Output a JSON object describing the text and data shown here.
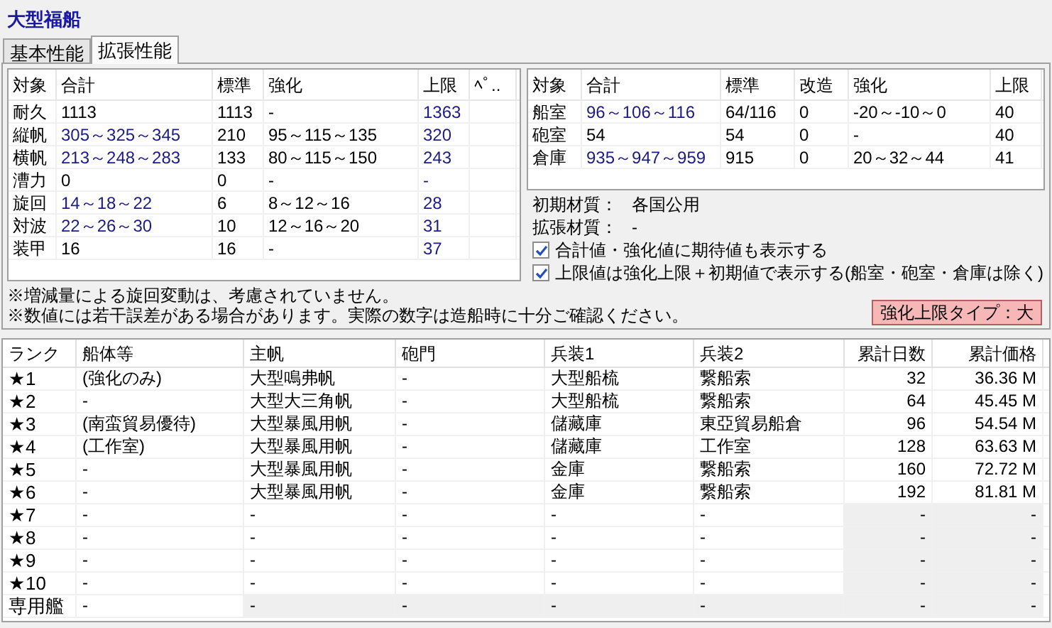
{
  "title": "大型福船",
  "tabs": [
    {
      "label": "基本性能",
      "selected": false
    },
    {
      "label": "拡張性能",
      "selected": true
    }
  ],
  "stats_table": {
    "columns": [
      "対象",
      "合計",
      "標準",
      "強化",
      "上限",
      "ﾍﾟ.."
    ],
    "rows": [
      {
        "cells": [
          {
            "text": "耐久",
            "accent": false
          },
          {
            "text": "1113",
            "accent": false
          },
          {
            "text": "1113",
            "accent": false
          },
          {
            "text": "-",
            "accent": false
          },
          {
            "text": "1363",
            "accent": true
          }
        ]
      },
      {
        "cells": [
          {
            "text": "縦帆",
            "accent": false
          },
          {
            "text": "305～325～345",
            "accent": true
          },
          {
            "text": "210",
            "accent": false
          },
          {
            "text": "95～115～135",
            "accent": false
          },
          {
            "text": "320",
            "accent": true
          }
        ]
      },
      {
        "cells": [
          {
            "text": "横帆",
            "accent": false
          },
          {
            "text": "213～248～283",
            "accent": true
          },
          {
            "text": "133",
            "accent": false
          },
          {
            "text": "80～115～150",
            "accent": false
          },
          {
            "text": "243",
            "accent": true
          }
        ]
      },
      {
        "cells": [
          {
            "text": "漕力",
            "accent": false
          },
          {
            "text": "0",
            "accent": false
          },
          {
            "text": "0",
            "accent": false
          },
          {
            "text": "-",
            "accent": false
          },
          {
            "text": "-",
            "accent": true
          }
        ]
      },
      {
        "cells": [
          {
            "text": "旋回",
            "accent": false
          },
          {
            "text": "14～18～22",
            "accent": true
          },
          {
            "text": "6",
            "accent": false
          },
          {
            "text": "8～12～16",
            "accent": false
          },
          {
            "text": "28",
            "accent": true
          }
        ]
      },
      {
        "cells": [
          {
            "text": "対波",
            "accent": false
          },
          {
            "text": "22～26～30",
            "accent": true
          },
          {
            "text": "10",
            "accent": false
          },
          {
            "text": "12～16～20",
            "accent": false
          },
          {
            "text": "31",
            "accent": true
          }
        ]
      },
      {
        "cells": [
          {
            "text": "装甲",
            "accent": false
          },
          {
            "text": "16",
            "accent": false
          },
          {
            "text": "16",
            "accent": false
          },
          {
            "text": "-",
            "accent": false
          },
          {
            "text": "37",
            "accent": true
          }
        ]
      }
    ]
  },
  "capacity_table": {
    "columns": [
      "対象",
      "合計",
      "標準",
      "改造",
      "強化",
      "上限"
    ],
    "rows": [
      {
        "cells": [
          {
            "text": "船室",
            "accent": false
          },
          {
            "text": "96～106～116",
            "accent": true
          },
          {
            "text": "64/116",
            "accent": false
          },
          {
            "text": "0",
            "accent": false
          },
          {
            "text": "-20～-10～0",
            "accent": false
          },
          {
            "text": "40",
            "accent": false
          }
        ]
      },
      {
        "cells": [
          {
            "text": "砲室",
            "accent": false
          },
          {
            "text": "54",
            "accent": false
          },
          {
            "text": "54",
            "accent": false
          },
          {
            "text": "0",
            "accent": false
          },
          {
            "text": "-",
            "accent": false
          },
          {
            "text": "40",
            "accent": false
          }
        ]
      },
      {
        "cells": [
          {
            "text": "倉庫",
            "accent": false
          },
          {
            "text": "935～947～959",
            "accent": true
          },
          {
            "text": "915",
            "accent": false
          },
          {
            "text": "0",
            "accent": false
          },
          {
            "text": "20～32～44",
            "accent": false
          },
          {
            "text": "41",
            "accent": false
          }
        ]
      }
    ]
  },
  "materials": [
    {
      "label": "初期材質：",
      "value": "各国公用"
    },
    {
      "label": "拡張材質：",
      "value": "-"
    }
  ],
  "options": [
    {
      "label": "合計値・強化値に期待値も表示する",
      "checked": true
    },
    {
      "label": "上限値は強化上限＋初期値で表示する(船室・砲室・倉庫は除く)",
      "checked": true
    }
  ],
  "notes": [
    "※増減量による旋回変動は、考慮されていません。",
    "※数値には若干誤差がある場合があります。実際の数字は造船時に十分ご確認ください。"
  ],
  "limit_type": "強化上限タイプ：大",
  "upgrade_table": {
    "columns": [
      "ランク",
      "船体等",
      "主帆",
      "砲門",
      "兵装1",
      "兵装2",
      "累計日数",
      "累計価格"
    ],
    "rows": [
      {
        "cells": [
          {
            "text": "★1",
            "disabled": false
          },
          {
            "text": "(強化のみ)",
            "disabled": false
          },
          {
            "text": "大型鳴弗帆",
            "disabled": false
          },
          {
            "text": "-",
            "disabled": false
          },
          {
            "text": "大型船梳",
            "disabled": false
          },
          {
            "text": "繋船索",
            "disabled": false
          },
          {
            "text": "32",
            "disabled": false
          },
          {
            "text": "36.36 M",
            "disabled": false
          }
        ]
      },
      {
        "cells": [
          {
            "text": "★2",
            "disabled": false
          },
          {
            "text": "-",
            "disabled": false
          },
          {
            "text": "大型大三角帆",
            "disabled": false
          },
          {
            "text": "-",
            "disabled": false
          },
          {
            "text": "大型船梳",
            "disabled": false
          },
          {
            "text": "繋船索",
            "disabled": false
          },
          {
            "text": "64",
            "disabled": false
          },
          {
            "text": "45.45 M",
            "disabled": false
          }
        ]
      },
      {
        "cells": [
          {
            "text": "★3",
            "disabled": false
          },
          {
            "text": "(南蛮貿易優待)",
            "disabled": false
          },
          {
            "text": "大型暴風用帆",
            "disabled": false
          },
          {
            "text": "-",
            "disabled": false
          },
          {
            "text": "儲藏庫",
            "disabled": false
          },
          {
            "text": "東亞貿易船倉",
            "disabled": false
          },
          {
            "text": "96",
            "disabled": false
          },
          {
            "text": "54.54 M",
            "disabled": false
          }
        ]
      },
      {
        "cells": [
          {
            "text": "★4",
            "disabled": false
          },
          {
            "text": "(工作室)",
            "disabled": false
          },
          {
            "text": "大型暴風用帆",
            "disabled": false
          },
          {
            "text": "-",
            "disabled": false
          },
          {
            "text": "儲藏庫",
            "disabled": false
          },
          {
            "text": "工作室",
            "disabled": false
          },
          {
            "text": "128",
            "disabled": false
          },
          {
            "text": "63.63 M",
            "disabled": false
          }
        ]
      },
      {
        "cells": [
          {
            "text": "★5",
            "disabled": false
          },
          {
            "text": "-",
            "disabled": false
          },
          {
            "text": "大型暴風用帆",
            "disabled": false
          },
          {
            "text": "-",
            "disabled": false
          },
          {
            "text": "金庫",
            "disabled": false
          },
          {
            "text": "繋船索",
            "disabled": false
          },
          {
            "text": "160",
            "disabled": false
          },
          {
            "text": "72.72 M",
            "disabled": false
          }
        ]
      },
      {
        "cells": [
          {
            "text": "★6",
            "disabled": false
          },
          {
            "text": "-",
            "disabled": false
          },
          {
            "text": "大型暴風用帆",
            "disabled": false
          },
          {
            "text": "-",
            "disabled": false
          },
          {
            "text": "金庫",
            "disabled": false
          },
          {
            "text": "繋船索",
            "disabled": false
          },
          {
            "text": "192",
            "disabled": false
          },
          {
            "text": "81.81 M",
            "disabled": false
          }
        ]
      },
      {
        "cells": [
          {
            "text": "★7",
            "disabled": false
          },
          {
            "text": "-",
            "disabled": false
          },
          {
            "text": "-",
            "disabled": false
          },
          {
            "text": "-",
            "disabled": false
          },
          {
            "text": "-",
            "disabled": false
          },
          {
            "text": "-",
            "disabled": false
          },
          {
            "text": "-",
            "disabled": true
          },
          {
            "text": "-",
            "disabled": true
          }
        ]
      },
      {
        "cells": [
          {
            "text": "★8",
            "disabled": false
          },
          {
            "text": "-",
            "disabled": false
          },
          {
            "text": "-",
            "disabled": false
          },
          {
            "text": "-",
            "disabled": false
          },
          {
            "text": "-",
            "disabled": false
          },
          {
            "text": "-",
            "disabled": false
          },
          {
            "text": "-",
            "disabled": true
          },
          {
            "text": "-",
            "disabled": true
          }
        ]
      },
      {
        "cells": [
          {
            "text": "★9",
            "disabled": false
          },
          {
            "text": "-",
            "disabled": false
          },
          {
            "text": "-",
            "disabled": false
          },
          {
            "text": "-",
            "disabled": false
          },
          {
            "text": "-",
            "disabled": false
          },
          {
            "text": "-",
            "disabled": false
          },
          {
            "text": "-",
            "disabled": true
          },
          {
            "text": "-",
            "disabled": true
          }
        ]
      },
      {
        "cells": [
          {
            "text": "★10",
            "disabled": false
          },
          {
            "text": "-",
            "disabled": false
          },
          {
            "text": "-",
            "disabled": false
          },
          {
            "text": "-",
            "disabled": false
          },
          {
            "text": "-",
            "disabled": false
          },
          {
            "text": "-",
            "disabled": false
          },
          {
            "text": "-",
            "disabled": true
          },
          {
            "text": "-",
            "disabled": true
          }
        ]
      },
      {
        "cells": [
          {
            "text": "専用艦",
            "disabled": false
          },
          {
            "text": "-",
            "disabled": false
          },
          {
            "text": "-",
            "disabled": true
          },
          {
            "text": "-",
            "disabled": true
          },
          {
            "text": "-",
            "disabled": true
          },
          {
            "text": "-",
            "disabled": true
          },
          {
            "text": "-",
            "disabled": true
          },
          {
            "text": "-",
            "disabled": true
          }
        ]
      }
    ]
  }
}
